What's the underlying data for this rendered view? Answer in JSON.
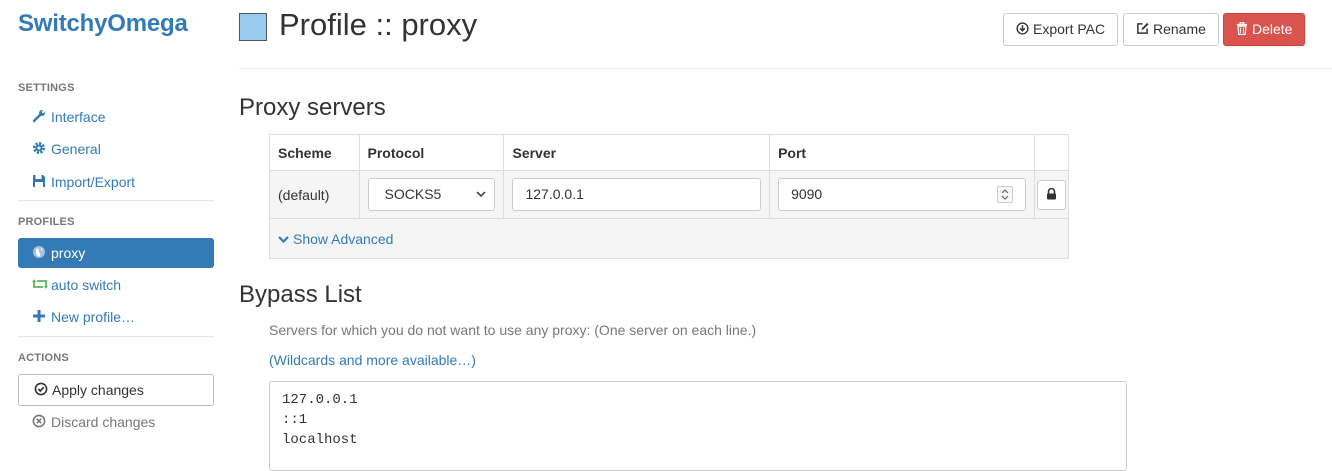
{
  "brand": "SwitchyOmega",
  "sidebar": {
    "settings_header": "SETTINGS",
    "settings_items": [
      {
        "label": "Interface",
        "icon": "wrench-icon"
      },
      {
        "label": "General",
        "icon": "gear-icon"
      },
      {
        "label": "Import/Export",
        "icon": "save-icon"
      }
    ],
    "profiles_header": "PROFILES",
    "profile_items": [
      {
        "label": "proxy",
        "icon": "globe-icon",
        "active": true
      },
      {
        "label": "auto switch",
        "icon": "retweet-icon",
        "active": false
      },
      {
        "label": "New profile…",
        "icon": "plus-icon",
        "active": false
      }
    ],
    "actions_header": "ACTIONS",
    "apply_label": "Apply changes",
    "discard_label": "Discard changes"
  },
  "header": {
    "title": "Profile :: proxy",
    "profile_color": "#99ccee",
    "export_label": "Export PAC",
    "rename_label": "Rename",
    "delete_label": "Delete"
  },
  "proxy_servers": {
    "title": "Proxy servers",
    "columns": [
      "Scheme",
      "Protocol",
      "Server",
      "Port"
    ],
    "row": {
      "scheme": "(default)",
      "protocol": "SOCKS5",
      "server": "127.0.0.1",
      "port": "9090"
    },
    "show_advanced_label": "Show Advanced"
  },
  "bypass": {
    "title": "Bypass List",
    "help_text": "Servers for which you do not want to use any proxy: (One server on each line.)",
    "wildcards_link": "(Wildcards and more available…)",
    "lines": [
      "127.0.0.1",
      "::1",
      "localhost"
    ]
  },
  "colors": {
    "accent": "#337ab7",
    "danger": "#d9534f",
    "muted": "#777777"
  }
}
